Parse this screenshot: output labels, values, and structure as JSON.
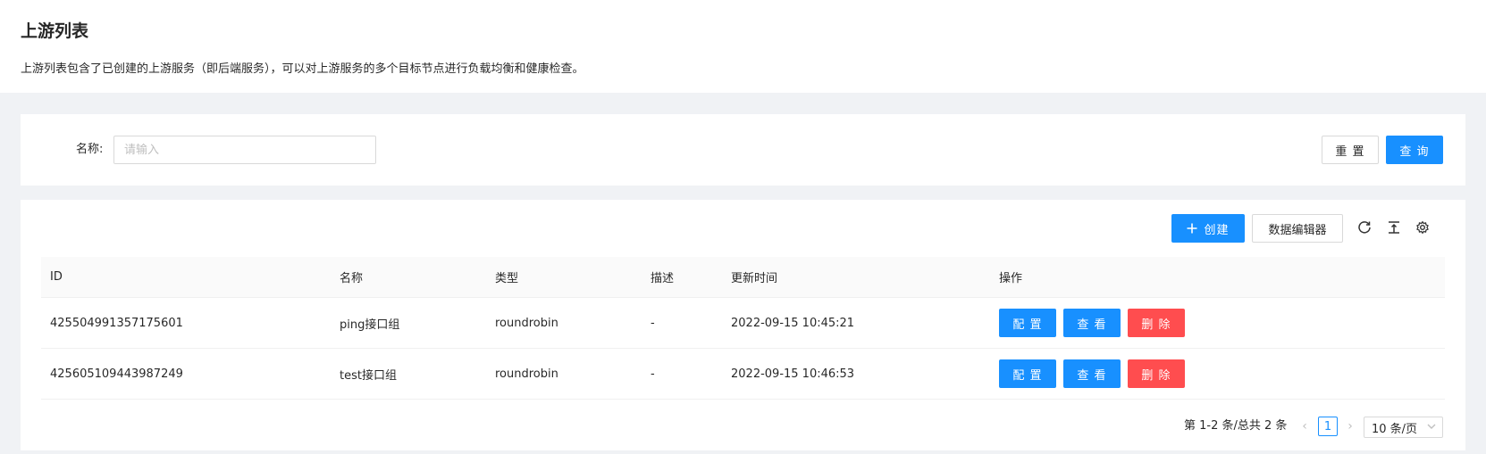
{
  "header": {
    "title": "上游列表",
    "description": "上游列表包含了已创建的上游服务（即后端服务），可以对上游服务的多个目标节点进行负载均衡和健康检查。"
  },
  "search": {
    "name_label": "名称:",
    "placeholder": "请输入",
    "value": "",
    "reset_label": "重 置",
    "query_label": "查 询"
  },
  "toolbar": {
    "create_label": "创建",
    "create_icon": "plus-icon",
    "data_editor_label": "数据编辑器",
    "icons": [
      "reload-icon",
      "density-icon",
      "settings-icon"
    ]
  },
  "table": {
    "columns": [
      "ID",
      "名称",
      "类型",
      "描述",
      "更新时间",
      "操作"
    ],
    "rows": [
      {
        "id": "425504991357175601",
        "name": "ping接口组",
        "type": "roundrobin",
        "desc": "-",
        "updated": "2022-09-15 10:45:21",
        "actions": [
          "配 置",
          "查 看",
          "删 除"
        ]
      },
      {
        "id": "425605109443987249",
        "name": "test接口组",
        "type": "roundrobin",
        "desc": "-",
        "updated": "2022-09-15 10:46:53",
        "actions": [
          "配 置",
          "查 看",
          "删 除"
        ]
      }
    ]
  },
  "pagination": {
    "total_text": "第 1-2 条/总共 2 条",
    "current_page": "1",
    "page_size": "10 条/页"
  },
  "colors": {
    "primary": "#1890ff",
    "danger": "#ff4d4f",
    "background": "#f0f2f5"
  }
}
